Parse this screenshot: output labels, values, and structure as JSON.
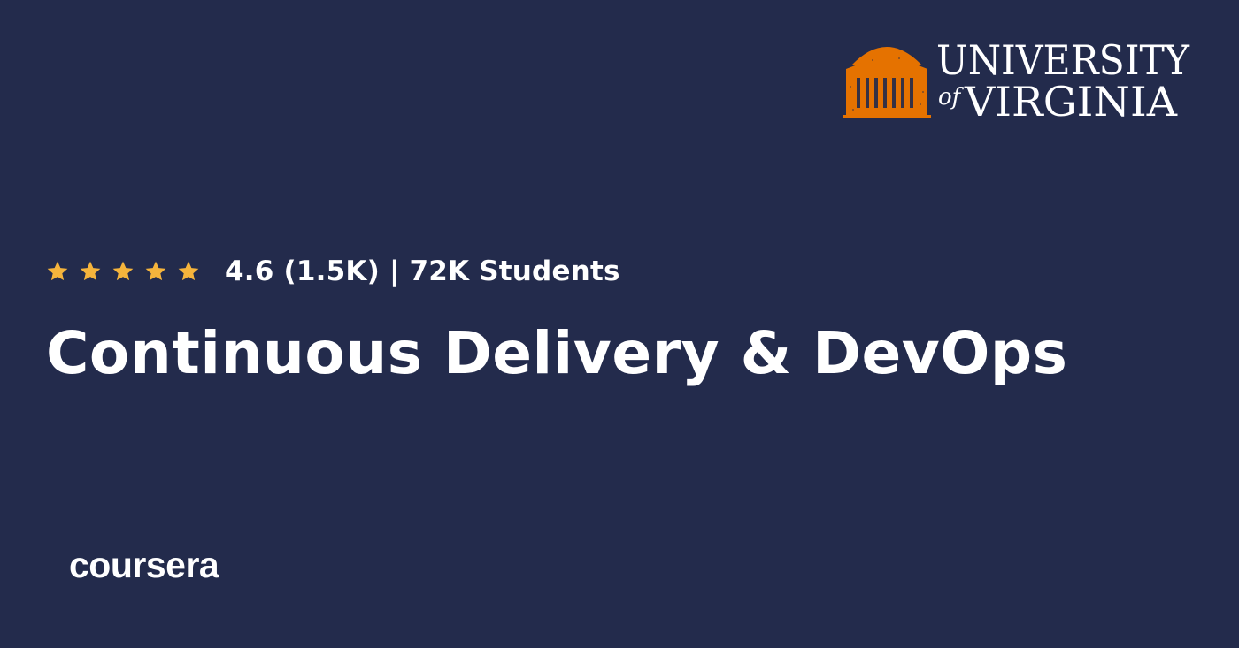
{
  "brand": {
    "university": {
      "line1": "UNIVERSITY",
      "line2_of": "of",
      "line2": "VIRGINIA",
      "color": "#e57200"
    },
    "platform": "coursera"
  },
  "rating": {
    "stars": 5,
    "star_color": "#f5b43c",
    "summary": "4.6 (1.5K) | 72K Students"
  },
  "course": {
    "title": "Continuous Delivery & DevOps"
  },
  "theme": {
    "background": "#232b4c",
    "text": "#ffffff"
  }
}
